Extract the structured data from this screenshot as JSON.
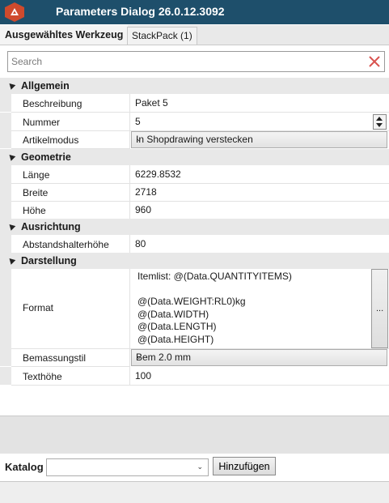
{
  "window": {
    "title": "Parameters Dialog 26.0.12.3092"
  },
  "tabs": [
    {
      "label": "Ausgewähltes Werkzeug",
      "active": true
    },
    {
      "label": "StackPack (1)",
      "active": false
    }
  ],
  "search": {
    "placeholder": "Search",
    "value": ""
  },
  "categories": {
    "allgemein": "Allgemein",
    "geometrie": "Geometrie",
    "ausrichtung": "Ausrichtung",
    "darstellung": "Darstellung"
  },
  "properties": {
    "beschreibung": {
      "label": "Beschreibung",
      "value": "Paket 5"
    },
    "nummer": {
      "label": "Nummer",
      "value": "5"
    },
    "artikelmodus": {
      "label": "Artikelmodus",
      "value": "In Shopdrawing verstecken"
    },
    "laenge": {
      "label": "Länge",
      "value": "6229.8532"
    },
    "breite": {
      "label": "Breite",
      "value": "2718"
    },
    "hoehe": {
      "label": "Höhe",
      "value": "960"
    },
    "abstandshalterhoehe": {
      "label": "Abstandshalterhöhe",
      "value": "80"
    },
    "format": {
      "label": "Format",
      "value": "Itemlist: @(Data.QUANTITYITEMS)\n\n@(Data.WEIGHT:RL0)kg\n@(Data.WIDTH)\n@(Data.LENGTH)\n@(Data.HEIGHT)",
      "button": "..."
    },
    "bemassungstil": {
      "label": "Bemassungstil",
      "value": "Bem 2.0 mm"
    },
    "texthoehe": {
      "label": "Texthöhe",
      "value": "100"
    }
  },
  "katalog": {
    "label": "Katalog",
    "selected": "",
    "add_button": "Hinzufügen"
  },
  "colors": {
    "titlebar": "#1e4f6b",
    "logo": "#cf4a2d",
    "clear_icon": "#d9534f"
  },
  "icons": {
    "logo": "app-logo-icon",
    "clear": "close-icon",
    "collapse": "collapse-triangle-icon"
  }
}
